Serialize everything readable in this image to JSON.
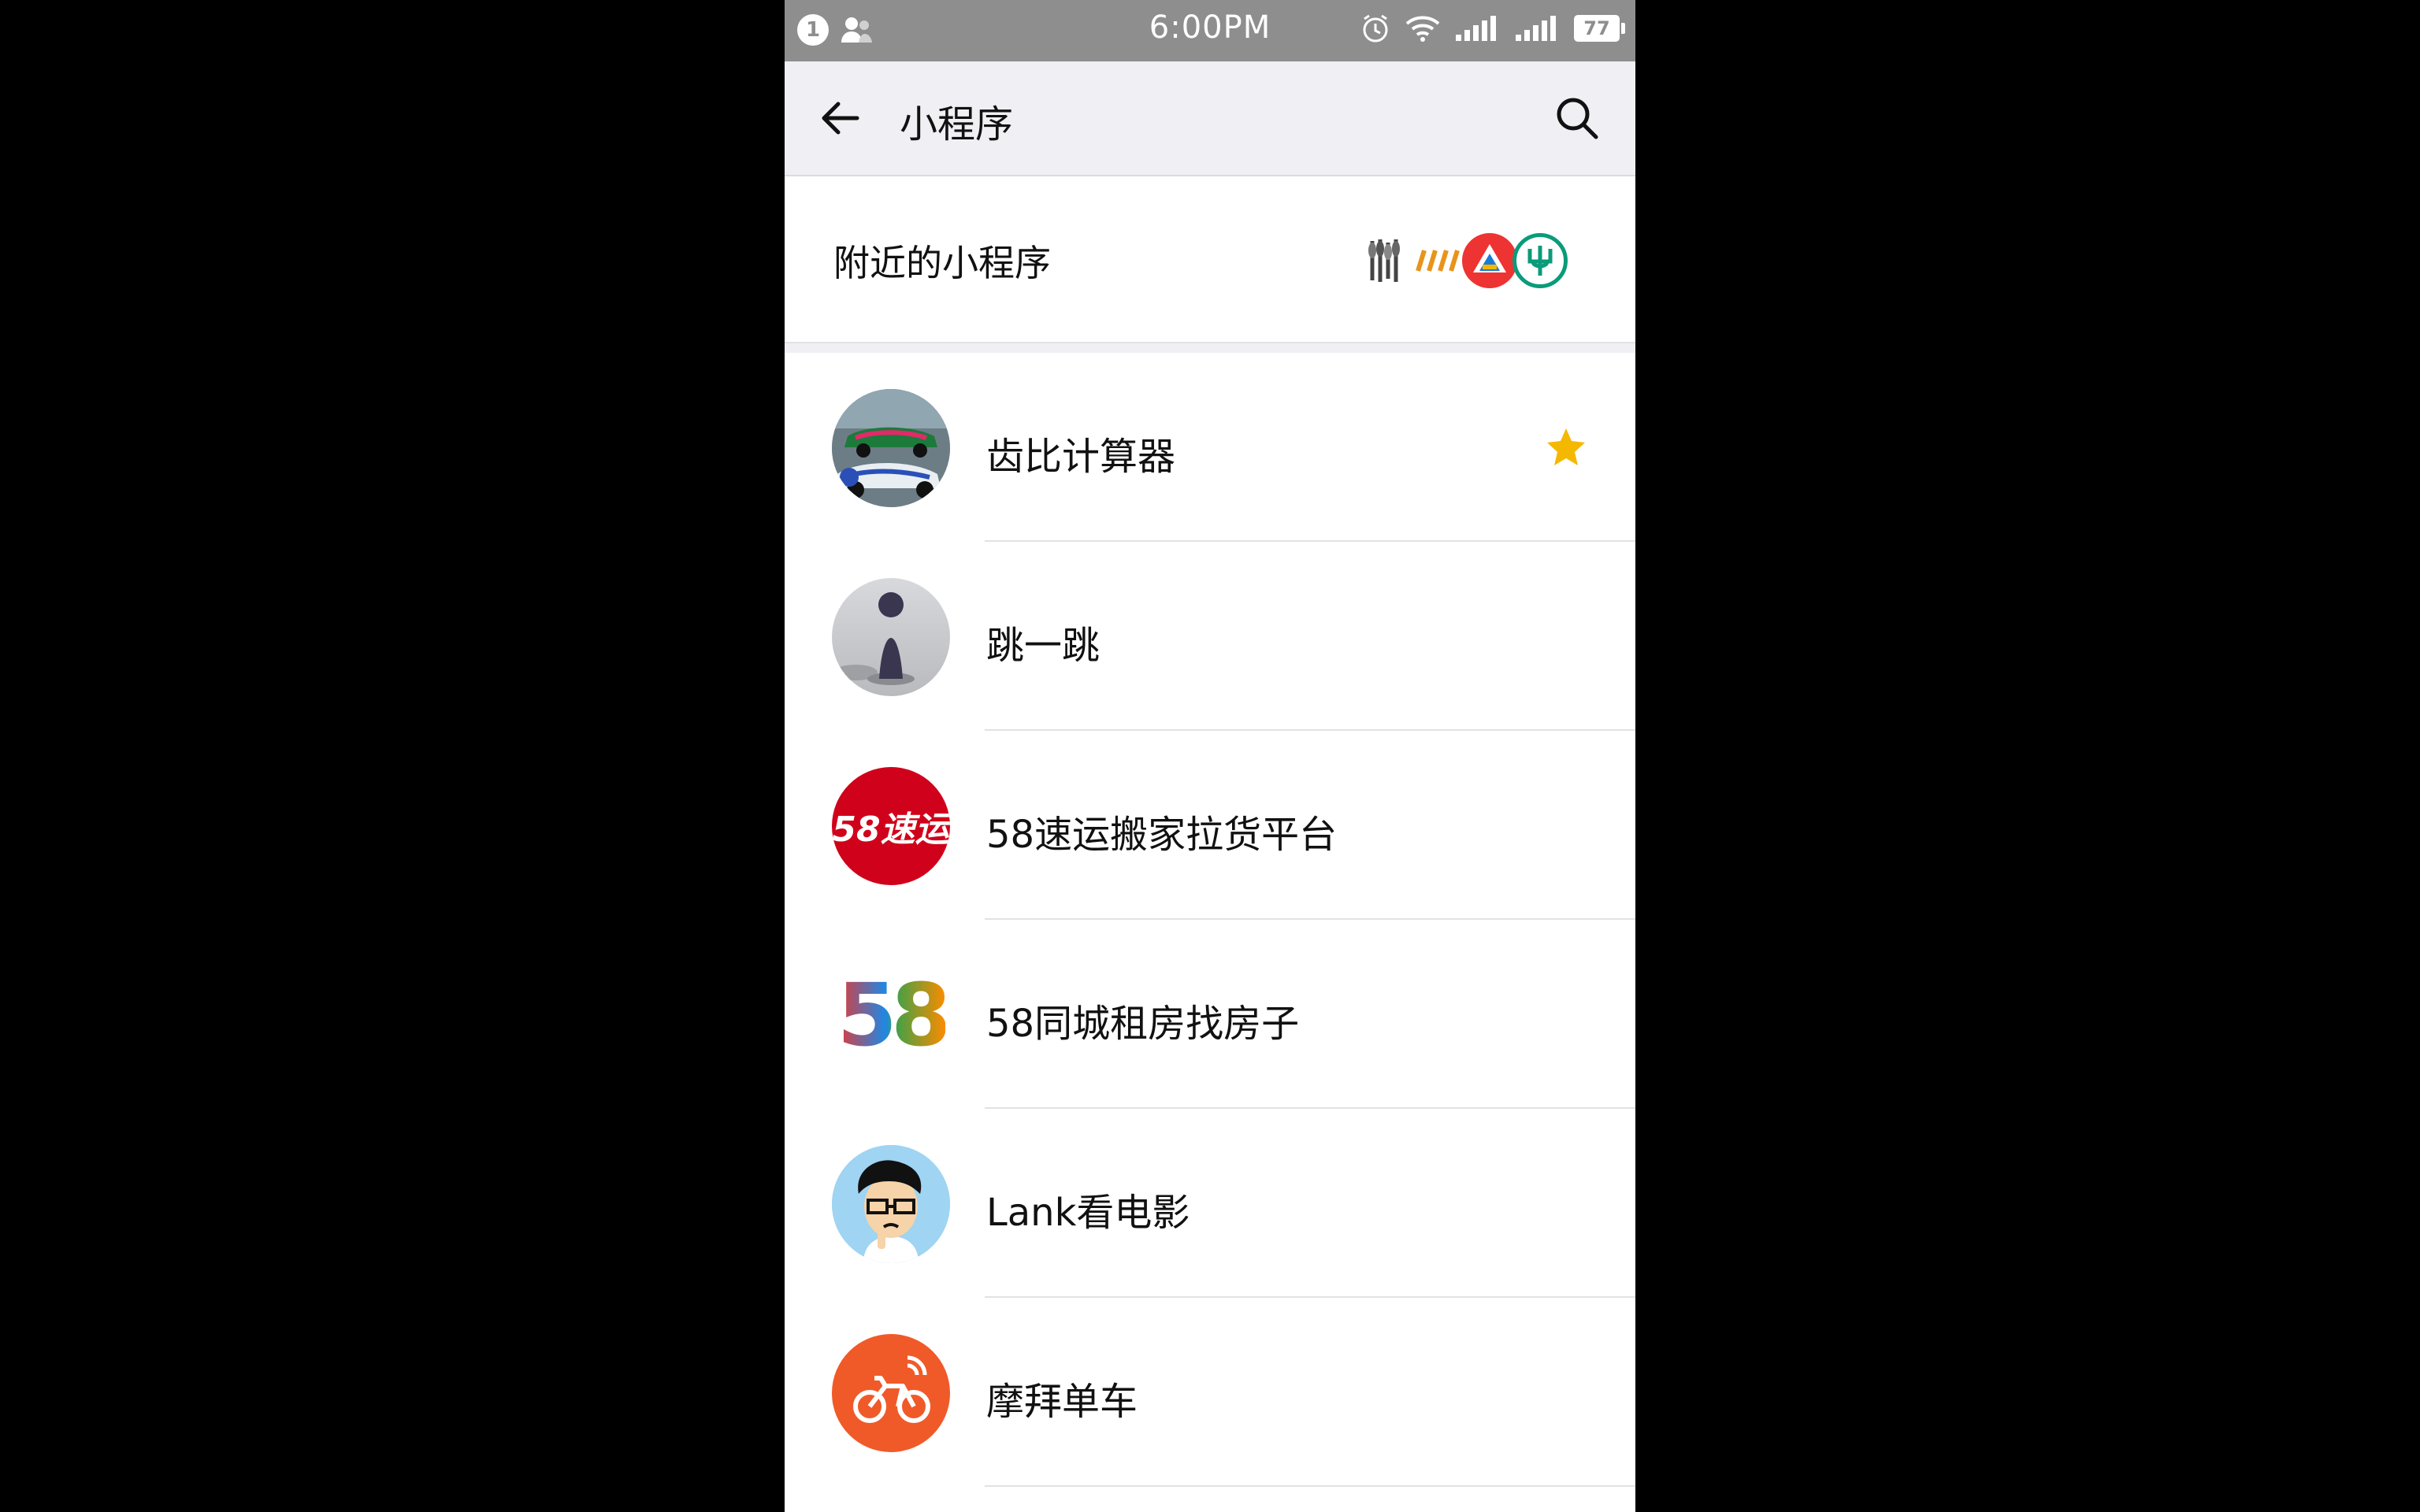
{
  "status_bar": {
    "notification_count": "1",
    "time": "6:00PM",
    "battery": "77"
  },
  "header": {
    "title": "小程序",
    "back_icon": "arrow-left-icon",
    "search_icon": "search-icon"
  },
  "nearby": {
    "label": "附近的小程序"
  },
  "programs": [
    {
      "name": "齿比计算器",
      "starred": true
    },
    {
      "name": "跳一跳",
      "starred": false
    },
    {
      "name": "58速运搬家拉货平台",
      "starred": false
    },
    {
      "name": "58同城租房找房子",
      "starred": false
    },
    {
      "name": "Lank看电影",
      "starred": false
    },
    {
      "name": "摩拜单车",
      "starred": false
    }
  ],
  "colors": {
    "status_bar": "#8e8e8e",
    "header_bg": "#efeff4",
    "star": "#f5b800",
    "red_58": "#d0021b",
    "mobike_orange": "#f05a28"
  },
  "logos": {
    "speed_58": "58速运",
    "tongcheng_58": "58"
  }
}
